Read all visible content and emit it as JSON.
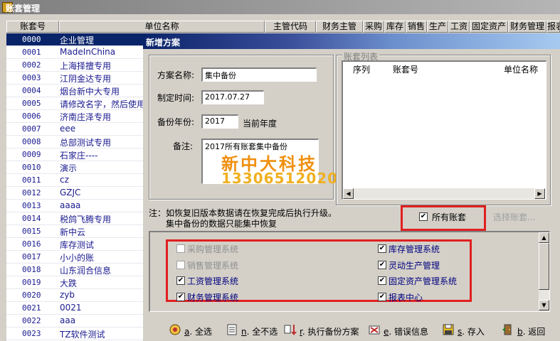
{
  "window": {
    "title": "账套管理"
  },
  "columns": [
    "账套号",
    "单位名称",
    "主管代码",
    "财务主管",
    "采购",
    "库存",
    "销售",
    "生产",
    "工资",
    "固定资产",
    "财务管理",
    "报表"
  ],
  "rows": [
    {
      "no": "0000",
      "name": "企业管理"
    },
    {
      "no": "0001",
      "name": "MadeInChina"
    },
    {
      "no": "0002",
      "name": "上海择擅专用"
    },
    {
      "no": "0003",
      "name": "江阴金达专用"
    },
    {
      "no": "0004",
      "name": "烟台新中大专用"
    },
    {
      "no": "0005",
      "name": "请修改名字，然后使用"
    },
    {
      "no": "0006",
      "name": "济南庄泽专用"
    },
    {
      "no": "0007",
      "name": "eee"
    },
    {
      "no": "0008",
      "name": "总部测试专用"
    },
    {
      "no": "0009",
      "name": "石家庄----"
    },
    {
      "no": "0010",
      "name": "演示"
    },
    {
      "no": "0011",
      "name": "cz"
    },
    {
      "no": "0012",
      "name": "GZJC"
    },
    {
      "no": "0013",
      "name": "aaaa"
    },
    {
      "no": "0014",
      "name": "税鸽飞腾专用"
    },
    {
      "no": "0015",
      "name": "新中云"
    },
    {
      "no": "0016",
      "name": "库存测试"
    },
    {
      "no": "0017",
      "name": "小小的账"
    },
    {
      "no": "0018",
      "name": "山东润合信息"
    },
    {
      "no": "0019",
      "name": "大跌"
    },
    {
      "no": "0020",
      "name": "zyb"
    },
    {
      "no": "0021",
      "name": "0021"
    },
    {
      "no": "0022",
      "name": "aaa"
    },
    {
      "no": "0023",
      "name": "TZ软件测试"
    }
  ],
  "dialog": {
    "title": "新增方案",
    "plan_name_label": "方案名称:",
    "plan_name_value": "集中备份",
    "date_label": "制定时间:",
    "date_value": "2017.07.27",
    "year_label": "备份年份:",
    "year_value": "2017",
    "year_suffix": "当前年度",
    "note_label": "备注:",
    "note_value": "2017所有账套集中备份",
    "watermark_line1": "新中大科技",
    "watermark_line2": "13306512020",
    "book_list_title": "账套列表",
    "book_list_columns": [
      "序列",
      "账套号",
      "单位名称"
    ],
    "notice_line1": "注：如恢复旧版本数据请在恢复完成后执行升级。",
    "notice_line2": "集中备份的数据只能集中恢复",
    "all_books_label": "所有账套",
    "select_books_label": "选择账套...",
    "systems_left": [
      {
        "label": "采购管理系统",
        "checked": false,
        "enabled": false
      },
      {
        "label": "销售管理系统",
        "checked": false,
        "enabled": false
      },
      {
        "label": "工资管理系统",
        "checked": true,
        "enabled": true
      },
      {
        "label": "财务管理系统",
        "checked": true,
        "enabled": true
      }
    ],
    "systems_right": [
      {
        "label": "库存管理系统",
        "checked": true
      },
      {
        "label": "灵动生产管理",
        "checked": true
      },
      {
        "label": "固定资产管理系统",
        "checked": true
      },
      {
        "label": "报表中心",
        "checked": true
      }
    ]
  },
  "buttons": [
    {
      "key": "a",
      "label": ". 全选"
    },
    {
      "key": "n",
      "label": ". 全不选"
    },
    {
      "key": "r",
      "label": ". 执行备份方案"
    },
    {
      "key": "e",
      "label": ". 错误信息"
    },
    {
      "key": "s",
      "label": ". 存入"
    },
    {
      "key": "b",
      "label": ". 返回"
    }
  ],
  "colors": {
    "selection": "#0a246a",
    "highlight_box": "#e02020",
    "watermark": "#f09010"
  }
}
